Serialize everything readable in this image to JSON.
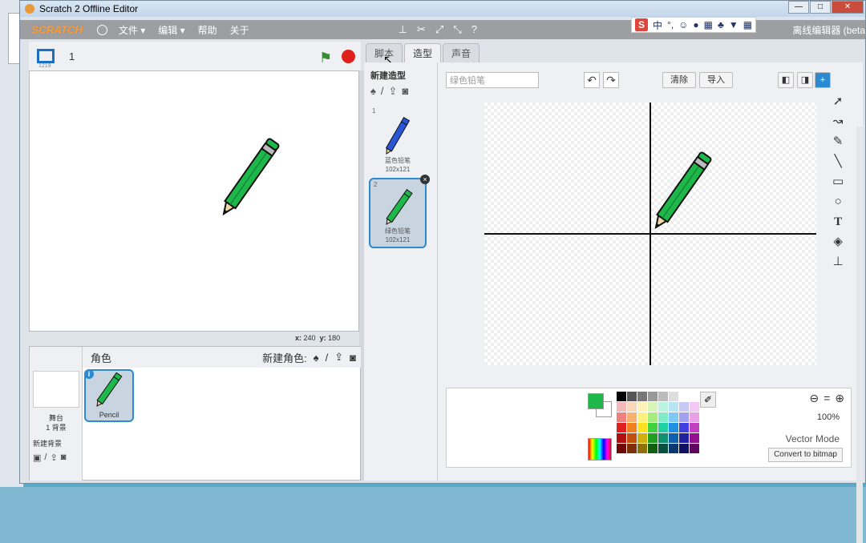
{
  "window": {
    "title": "Scratch 2 Offline Editor"
  },
  "menu": {
    "logo": "SCRATCH",
    "file": "文件 ▾",
    "edit": "编辑 ▾",
    "help": "帮助",
    "about": "关于",
    "offline_label": "离线编辑器 (beta"
  },
  "ime": {
    "lang": "中",
    "punct": "°,"
  },
  "stage": {
    "version": "1219",
    "sprite_count": "1",
    "coords_x_label": "x:",
    "coords_x": "240",
    "coords_y_label": "y:",
    "coords_y": "180"
  },
  "sprites": {
    "header": "角色",
    "new_label": "新建角色:",
    "stage_label": "舞台",
    "stage_bg_count": "1 背景",
    "new_backdrop": "新建背景",
    "items": [
      {
        "name": "Pencil"
      }
    ]
  },
  "tabs": [
    {
      "label": "脚本"
    },
    {
      "label": "造型"
    },
    {
      "label": "声音"
    }
  ],
  "costumes": {
    "header": "新建造型",
    "items": [
      {
        "index": "1",
        "name": "蓝色铅笔",
        "size": "102x121",
        "color": "#2a55d4"
      },
      {
        "index": "2",
        "name": "绿色铅笔",
        "size": "102x121",
        "color": "#1eb84a"
      }
    ]
  },
  "editor": {
    "costume_name": "绿色铅笔",
    "clear": "清除",
    "import": "导入",
    "zoom": "100%",
    "mode": "Vector Mode",
    "convert": "Convert to bitmap",
    "fill_color": "#1eb84a"
  },
  "palette": [
    "#000000",
    "#555555",
    "#777777",
    "#999999",
    "#bbbbbb",
    "#dddddd",
    "#ffffff",
    "#ffffff",
    "#f4b8b8",
    "#f8d8b8",
    "#fff2b8",
    "#d8f4b8",
    "#b8f4e0",
    "#b8e4f4",
    "#c8c8f4",
    "#f4c8f4",
    "#f08080",
    "#f8b070",
    "#fff080",
    "#a8ec80",
    "#80ecc8",
    "#80c8f4",
    "#a0a0f0",
    "#e8a0e8",
    "#e02020",
    "#f08020",
    "#ffe020",
    "#40d040",
    "#20d0a0",
    "#2090e0",
    "#4040e0",
    "#c040c0",
    "#b01010",
    "#c05010",
    "#d0b010",
    "#20a020",
    "#109070",
    "#1060b0",
    "#2020a0",
    "#901090",
    "#700808",
    "#803008",
    "#907008",
    "#106010",
    "#085040",
    "#083870",
    "#101060",
    "#600860"
  ]
}
